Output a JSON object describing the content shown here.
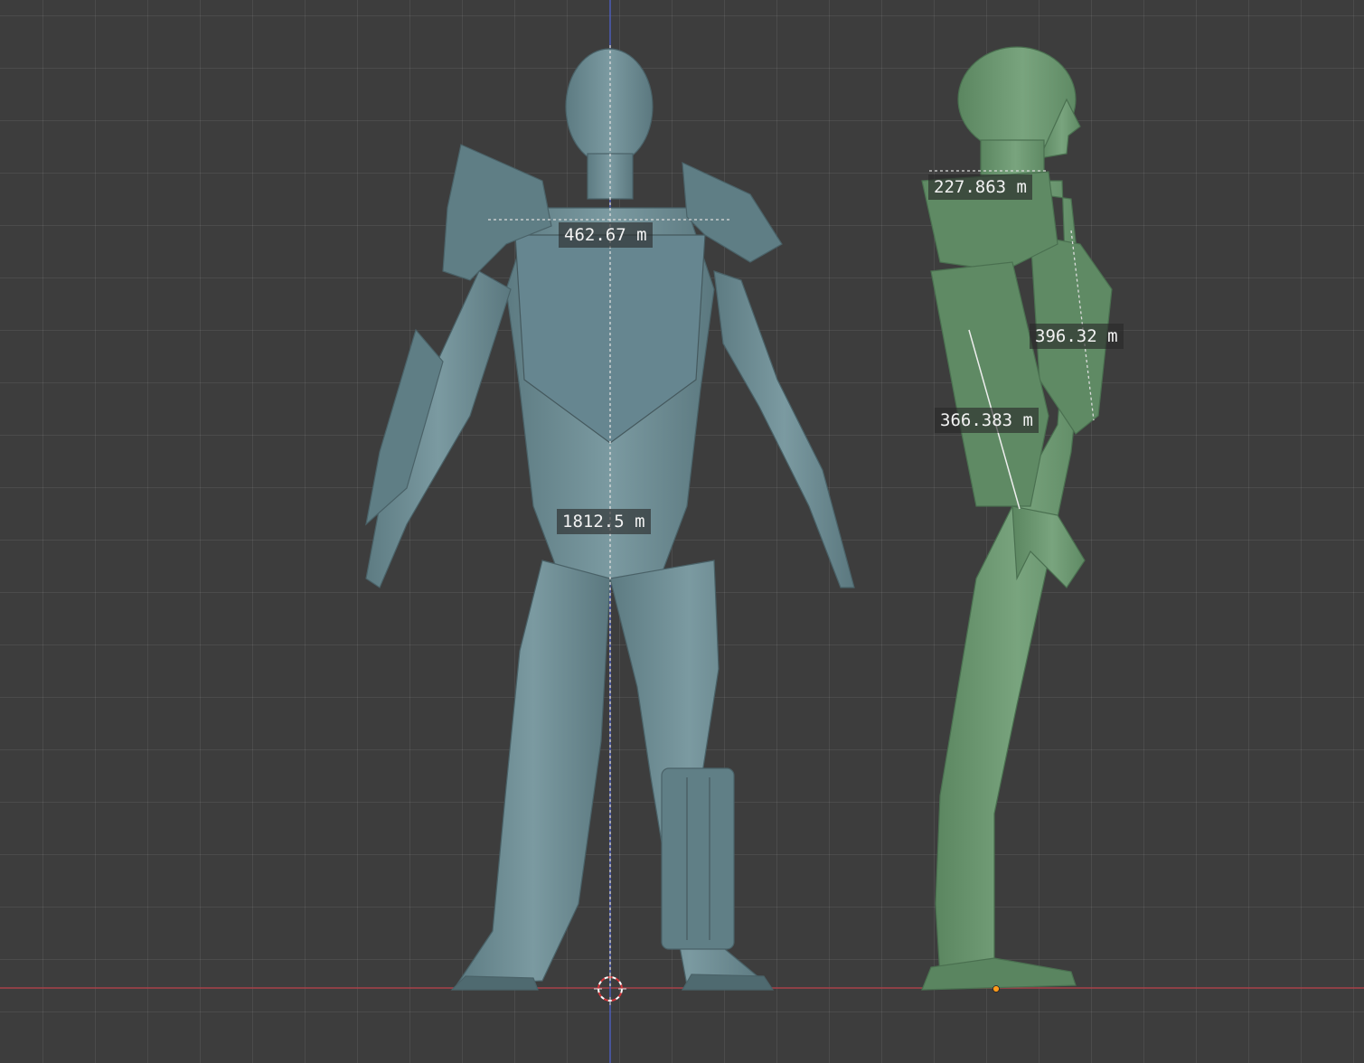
{
  "viewport": {
    "background_color": "#3d3d3d",
    "grid_color": "#4a4a4a",
    "x_axis_color": "#b3424a",
    "z_axis_color": "#4f63d6",
    "front_model_color": "#6f8f96",
    "side_model_color": "#6f9a74"
  },
  "measurements": {
    "front_shoulder_width": "462.67 m",
    "front_height": "1812.5 m",
    "side_neck_depth": "227.863 m",
    "side_torso_depth": "396.32 m",
    "side_arm_length": "366.383 m"
  },
  "icons": {
    "cursor": "3d-cursor-icon",
    "origin": "object-origin-icon"
  }
}
